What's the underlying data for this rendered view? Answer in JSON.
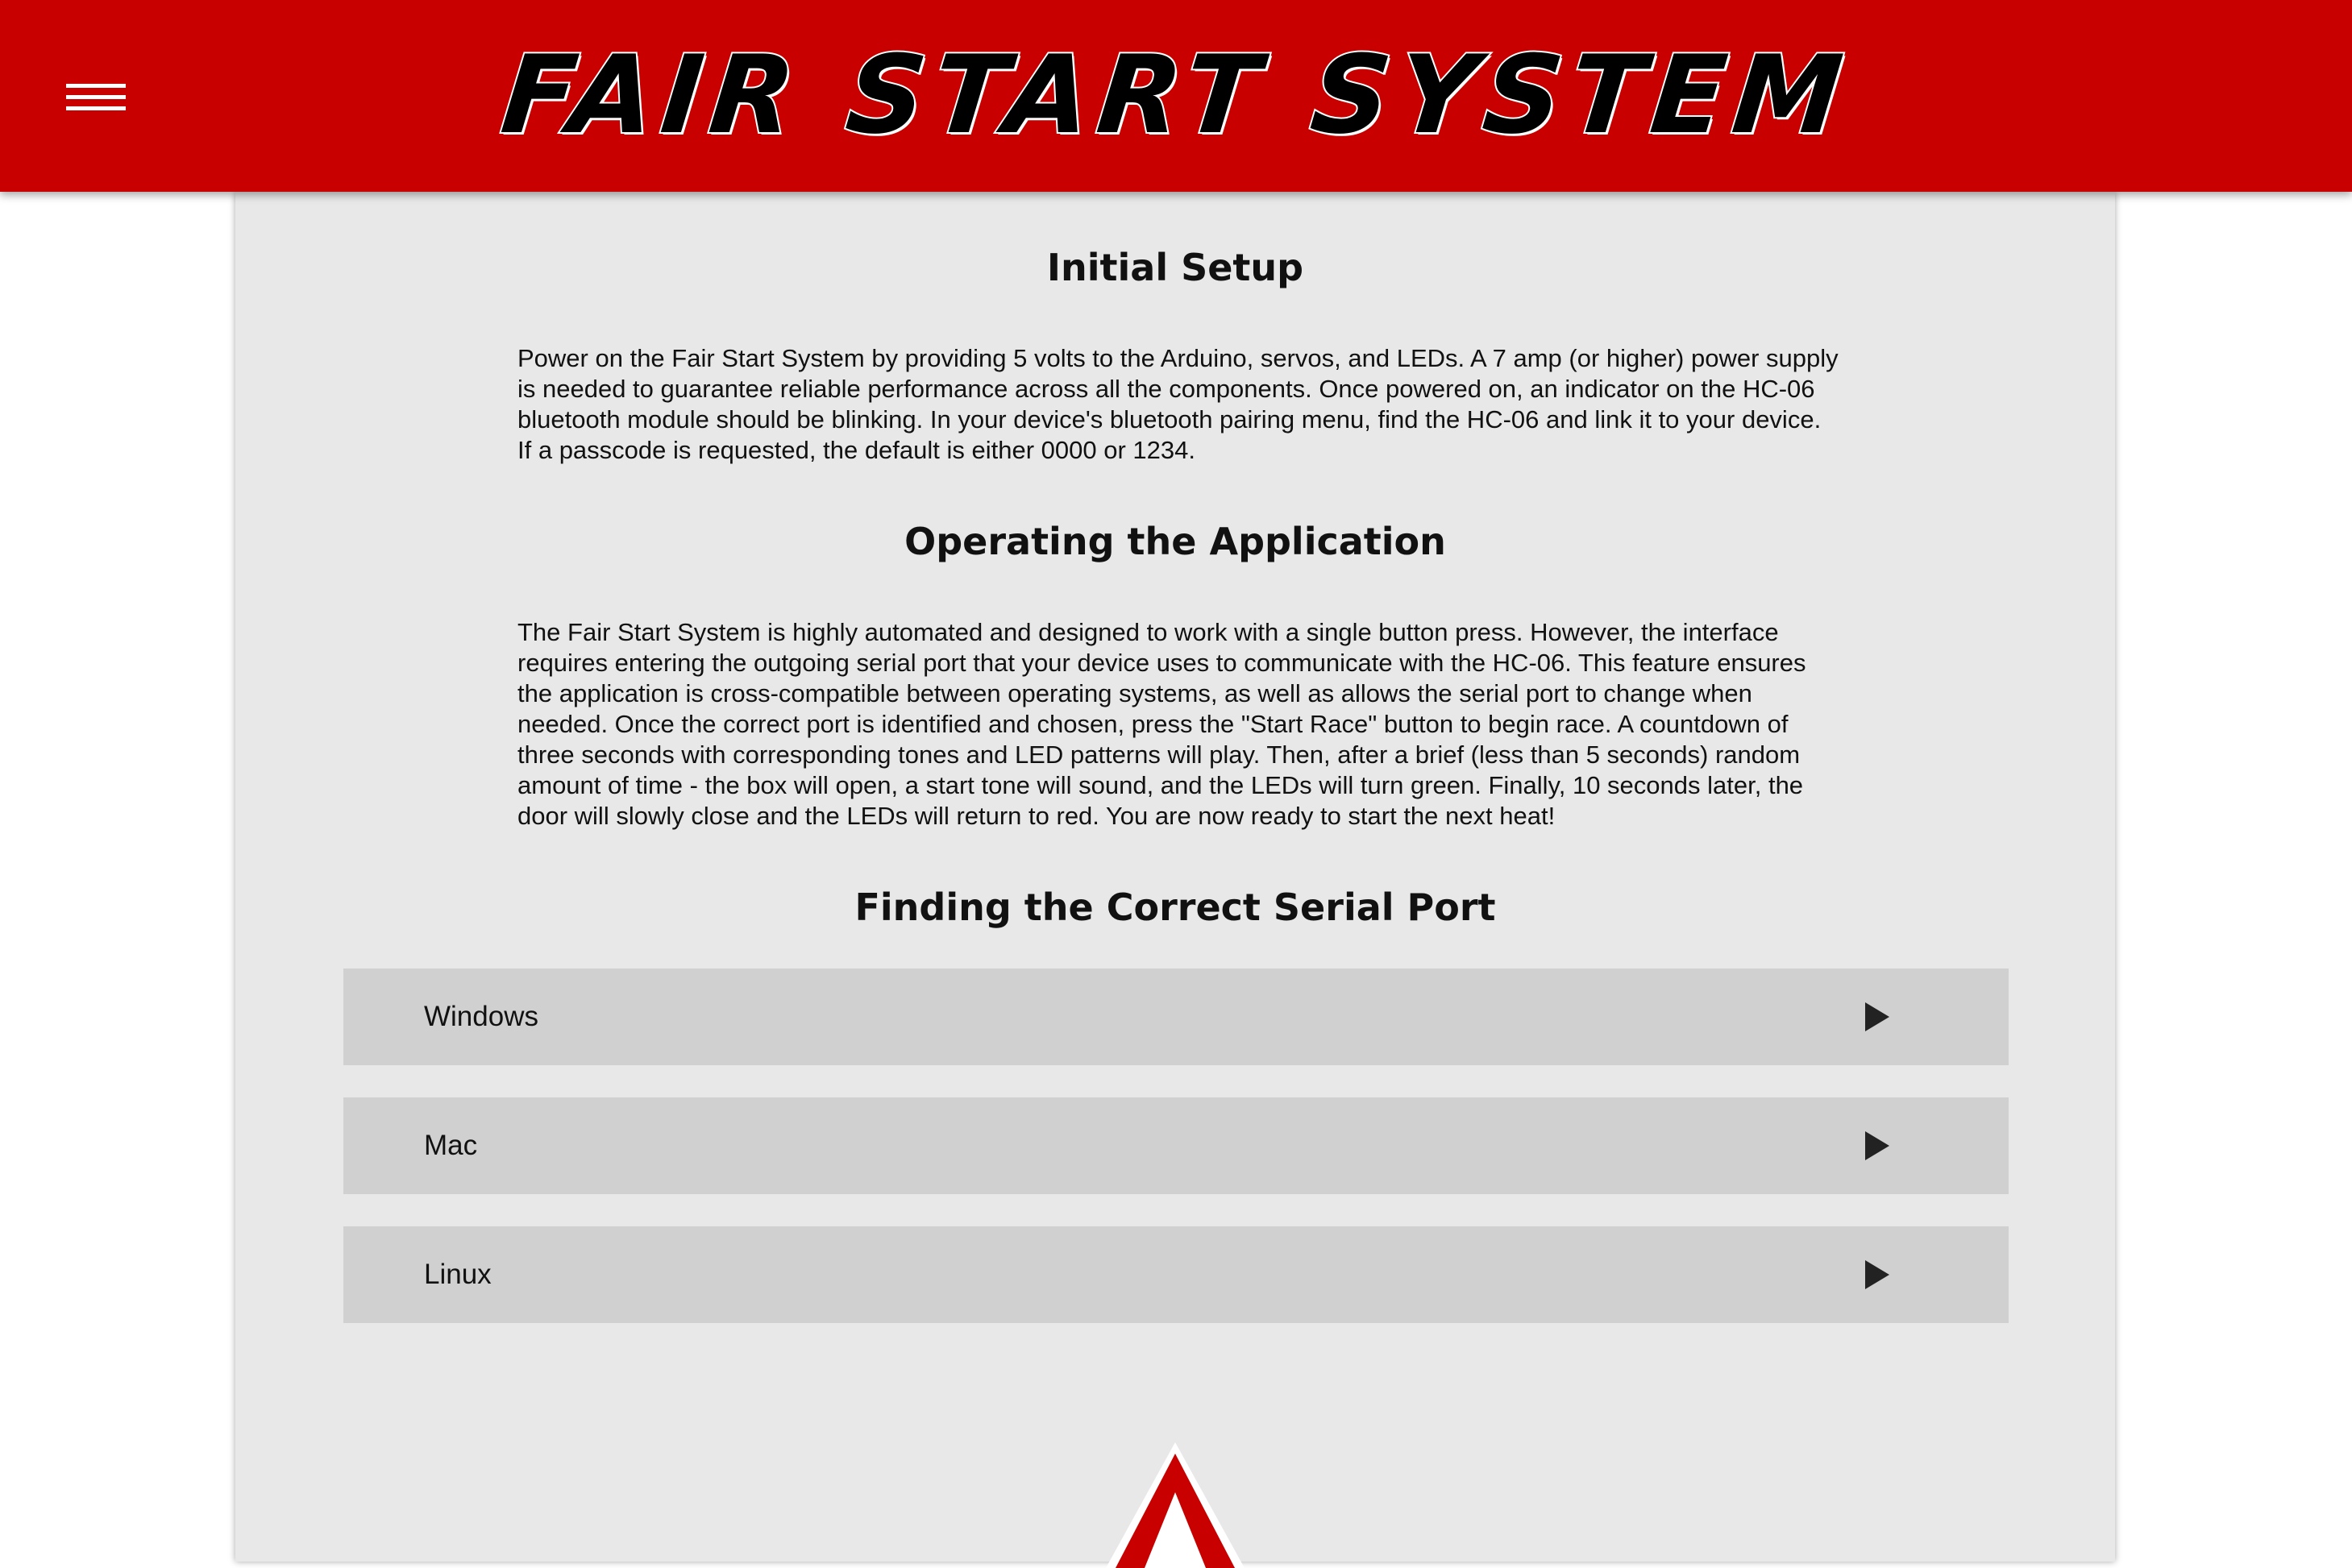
{
  "header": {
    "logo_text": "FAIR START SYSTEM",
    "menu_icon": "hamburger-menu-icon",
    "background_color": "#c90000"
  },
  "sections": [
    {
      "title": "Initial Setup",
      "text": "Power on the Fair Start System by providing 5 volts to the Arduino, servos, and LEDs. A 7 amp (or higher) power supply is needed to guarantee reliable performance across all the components. Once powered on, an indicator on the HC-06 bluetooth module should be blinking. In your device's bluetooth pairing menu, find the HC-06 and link it to your device. If a passcode is requested, the default is either 0000 or 1234."
    },
    {
      "title": "Operating the Application",
      "text": "The Fair Start System is highly automated and designed to work with a single button press. However, the interface requires entering the outgoing serial port that your device uses to communicate with the HC-06. This feature ensures the application is cross-compatible between operating systems, as well as allows the serial port to change when needed. Once the correct port is identified and chosen, press the \"Start Race\" button to begin race. A countdown of three seconds with corresponding tones and LED patterns will play. Then, after a brief (less than 5 seconds) random amount of time - the box will open, a start tone will sound, and the LEDs will turn green. Finally, 10 seconds later, the door will slowly close and the LEDs will return to red. You are now ready to start the next heat!"
    },
    {
      "title": "Finding the Correct Serial Port"
    }
  ],
  "accordion": [
    {
      "label": "Windows",
      "icon": "play-arrow-icon"
    },
    {
      "label": "Mac",
      "icon": "play-arrow-icon"
    },
    {
      "label": "Linux",
      "icon": "play-arrow-icon"
    }
  ],
  "footer": {
    "logo_icon": "triangle-logo-icon",
    "accent_color": "#c90000"
  }
}
